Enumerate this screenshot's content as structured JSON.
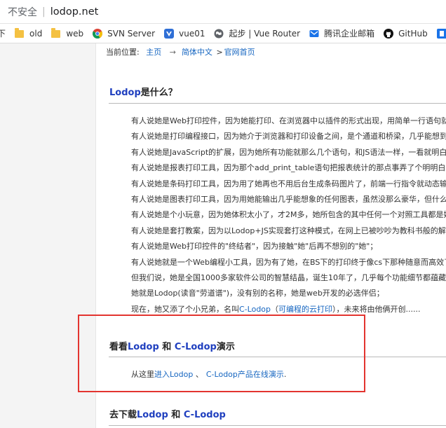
{
  "address_bar": {
    "security": "不安全",
    "url": "lodop.net"
  },
  "bookmarks": [
    {
      "label": "下",
      "icon": "none"
    },
    {
      "label": "old",
      "icon": "folder-icon"
    },
    {
      "label": "web",
      "icon": "folder-icon"
    },
    {
      "label": "SVN Server",
      "icon": "chrome-icon"
    },
    {
      "label": "vue01",
      "icon": "vue-icon"
    },
    {
      "label": "起步 | Vue Router",
      "icon": "globe-icon"
    },
    {
      "label": "腾讯企业邮箱",
      "icon": "tencent-mail-icon"
    },
    {
      "label": "GitHub",
      "icon": "github-icon"
    },
    {
      "label": "",
      "icon": "app-icon"
    }
  ],
  "breadcrumb": {
    "prefix": "当前位置:",
    "home": "主页",
    "sep": "→",
    "lang": "简体中文",
    "sep2": ">",
    "page": "官网首页"
  },
  "section1": {
    "title_blue": "Lodop",
    "title_rest": "是什么？"
  },
  "intro_lines": [
    "有人说她是Web打印控件，因为她能打印、在浏览器中以插件的形式出现，用简单一行语句就",
    "有人说她是打印编程接口，因为她介于浏览器和打印设备之间，是个通道和桥梁，几乎能想到",
    "有人说她是JavaScript的扩展，因为她所有功能就那么几个语句，和JS语法一样，一看就明白个",
    "有人说她是报表打印工具，因为那个add_print_table语句把报表统计的那点事弄了个明明白白",
    "有人说她是条码打印工具，因为用了她再也不用后台生成条码图片了，前端一行指令就动态输",
    "有人说她是图表打印工具，因为用她能输出几乎能想象的任何图表，虽然没那么豪华，但什么",
    "有人说她是个小玩意，因为她体积太小了，才2M多，她所包含的其中任何一个对照工具都是她",
    "有人说她是套打教案，因为以Lodop+JS实现套打这种模式，在网上已被吵吵为教科书般的解决",
    "有人说她是Web打印控件的\"终结者\"，因为接触\"她\"后再不想别的\"她\"；",
    "有人说她就是一个Web编程小工具，因为有了她，在BS下的打印终于像cs下那种随意而高效了",
    "但我们说，她是全国1000多家软件公司的智慧结晶，诞生10年了，几乎每个功能细节都蕴藏着",
    "她就是Lodop(读音\"劳道谱\")，没有别的名称，她是web开发的必选伴侣；"
  ],
  "last_line": {
    "before": "现在，她又添了个小兄弟，名叫",
    "link1": "C-Lodop",
    "mid": "（",
    "link2": "可编程的云打印",
    "after": "），未来将由他俩开创......"
  },
  "section2": {
    "prefix": "看看",
    "blue1": "Lodop",
    "and": " 和 ",
    "blue2": "C-Lodop",
    "suffix": "演示"
  },
  "demo_line": {
    "before": "从这里",
    "link1": "进入Lodop",
    "mid": " 、",
    "link2": "C-Lodop产品在线演示",
    "after": "."
  },
  "section3": {
    "prefix": "去下载",
    "blue1": "Lodop",
    "and": " 和 ",
    "blue2": "C-Lodop"
  },
  "colors": {
    "link": "#1565c0",
    "title_blue": "#1f3fbf",
    "highlight_box": "#e3342f"
  }
}
